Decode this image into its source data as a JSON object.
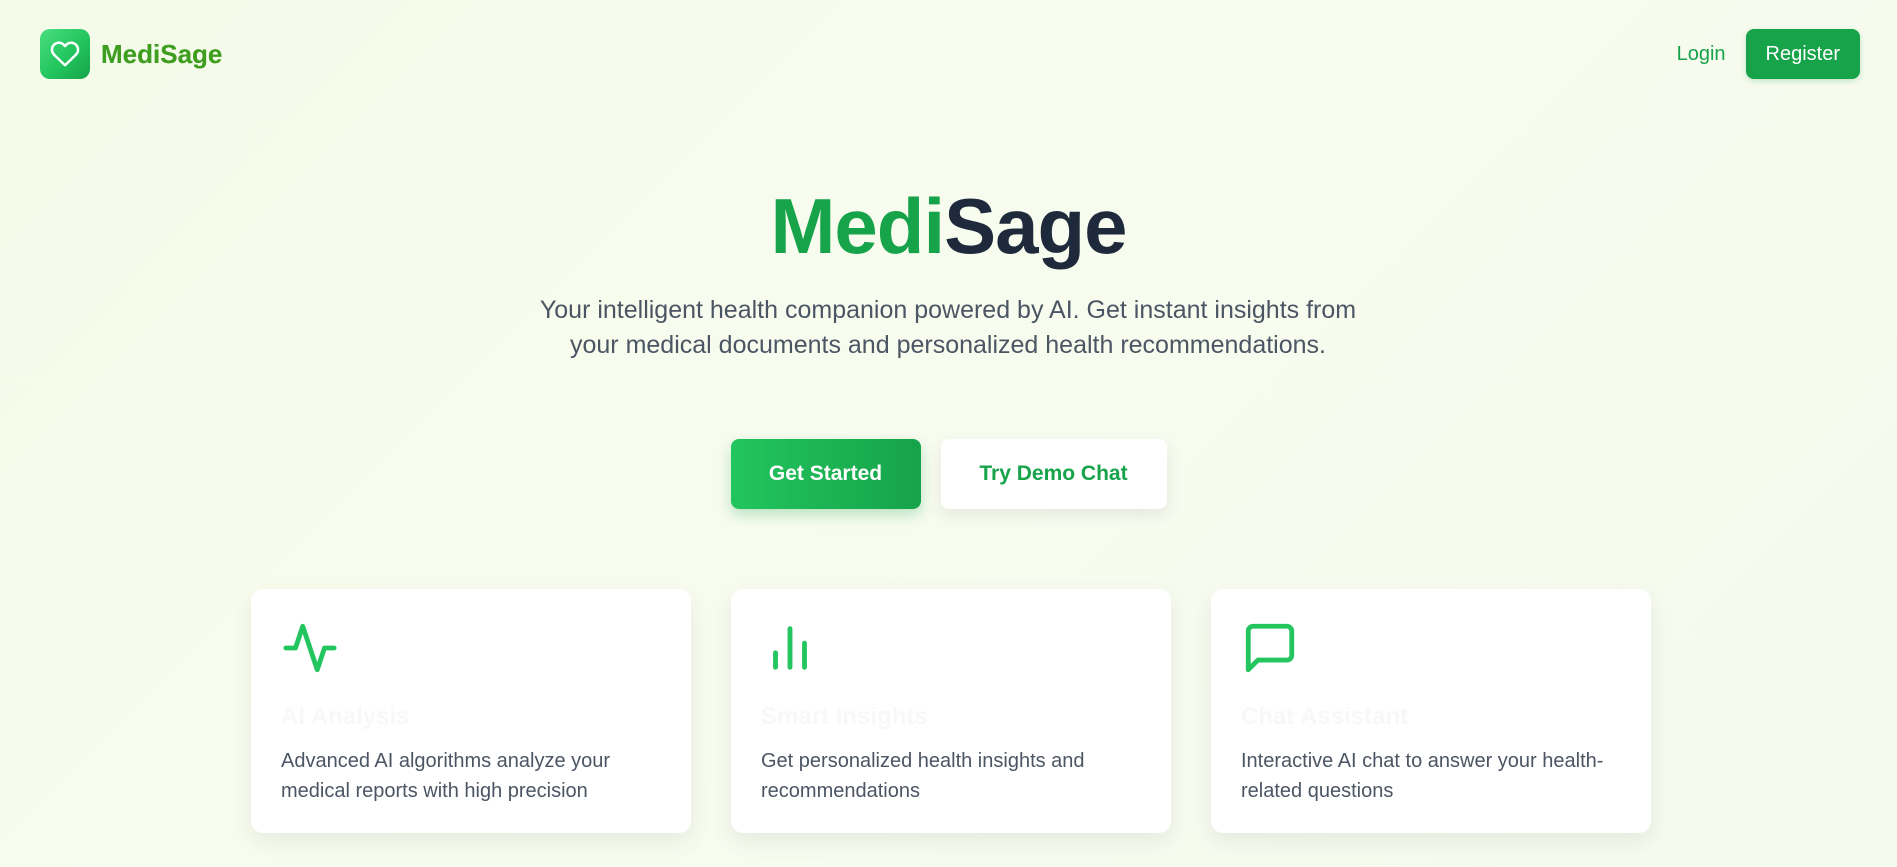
{
  "header": {
    "brand_name": "MediSage",
    "login_label": "Login",
    "register_label": "Register"
  },
  "hero": {
    "title_part1": "Medi",
    "title_part2": "Sage",
    "subtitle": "Your intelligent health companion powered by AI. Get instant insights from your medical documents and personalized health recommendations.",
    "primary_cta": "Get Started",
    "secondary_cta": "Try Demo Chat"
  },
  "features": [
    {
      "icon": "activity-pulse-icon",
      "title": "AI Analysis",
      "description": "Advanced AI algorithms analyze your medical reports with high precision"
    },
    {
      "icon": "bar-chart-icon",
      "title": "Smart Insights",
      "description": "Get personalized health insights and recommendations"
    },
    {
      "icon": "chat-bubble-icon",
      "title": "Chat Assistant",
      "description": "Interactive AI chat to answer your health-related questions"
    }
  ],
  "colors": {
    "brand_green": "#16a34a",
    "accent_green": "#22c55e",
    "heading_dark": "#1e293b",
    "body_text": "#4b5563"
  }
}
